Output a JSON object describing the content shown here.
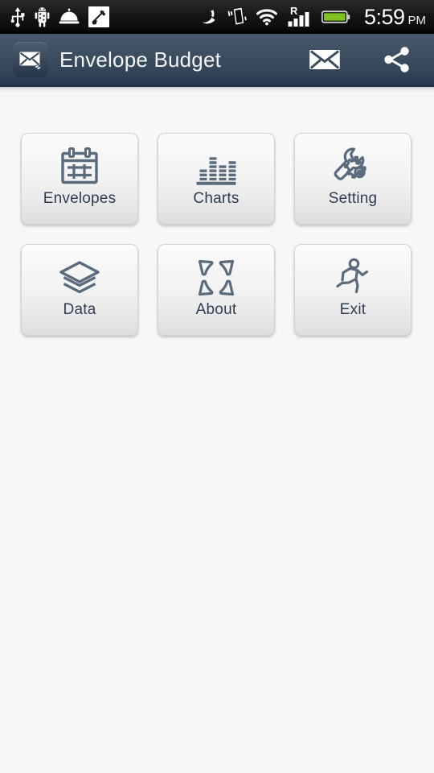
{
  "status_bar": {
    "left_icons": [
      {
        "name": "usb-icon",
        "label": "USB connected"
      },
      {
        "name": "android-debug-icon",
        "label": "USB debugging"
      },
      {
        "name": "service-bell-icon",
        "label": "Notification"
      },
      {
        "name": "notification-slash-icon",
        "label": "App notification"
      }
    ],
    "right_icons": [
      {
        "name": "gps-icon",
        "label": "GPS"
      },
      {
        "name": "vibrate-icon",
        "label": "Vibrate mode"
      },
      {
        "name": "wifi-icon",
        "label": "Wi-Fi"
      },
      {
        "name": "roaming-signal-icon",
        "label": "R"
      },
      {
        "name": "battery-icon",
        "label": "Battery"
      }
    ],
    "roaming_label": "R",
    "time": "5:59",
    "meridiem": "PM",
    "colors": {
      "background": "#0d0d0d",
      "text": "#ffffff",
      "battery": "#7ec224"
    }
  },
  "action_bar": {
    "app_icon": "envelope-app-icon",
    "title": "Envelope Budget",
    "actions": [
      {
        "name": "mail-icon",
        "label": "Mail"
      },
      {
        "name": "share-icon",
        "label": "Share"
      }
    ],
    "colors": {
      "background": "#3b4c5e",
      "title": "#f2f4f6",
      "border": "#1b2e43"
    }
  },
  "main": {
    "rows": [
      [
        {
          "label": "Envelopes",
          "icon": "calendar-grid-icon"
        },
        {
          "label": "Charts",
          "icon": "bar-chart-icon"
        },
        {
          "label": "Setting",
          "icon": "wrench-gear-icon"
        }
      ],
      [
        {
          "label": "Data",
          "icon": "layers-icon"
        },
        {
          "label": "About",
          "icon": "corners-expand-icon"
        },
        {
          "label": "Exit",
          "icon": "running-person-icon"
        }
      ]
    ],
    "colors": {
      "background": "#f7f7f8",
      "tile_face": "#f3f3f3",
      "label": "#2e3d52",
      "glyph": "#5b6b7c"
    }
  }
}
